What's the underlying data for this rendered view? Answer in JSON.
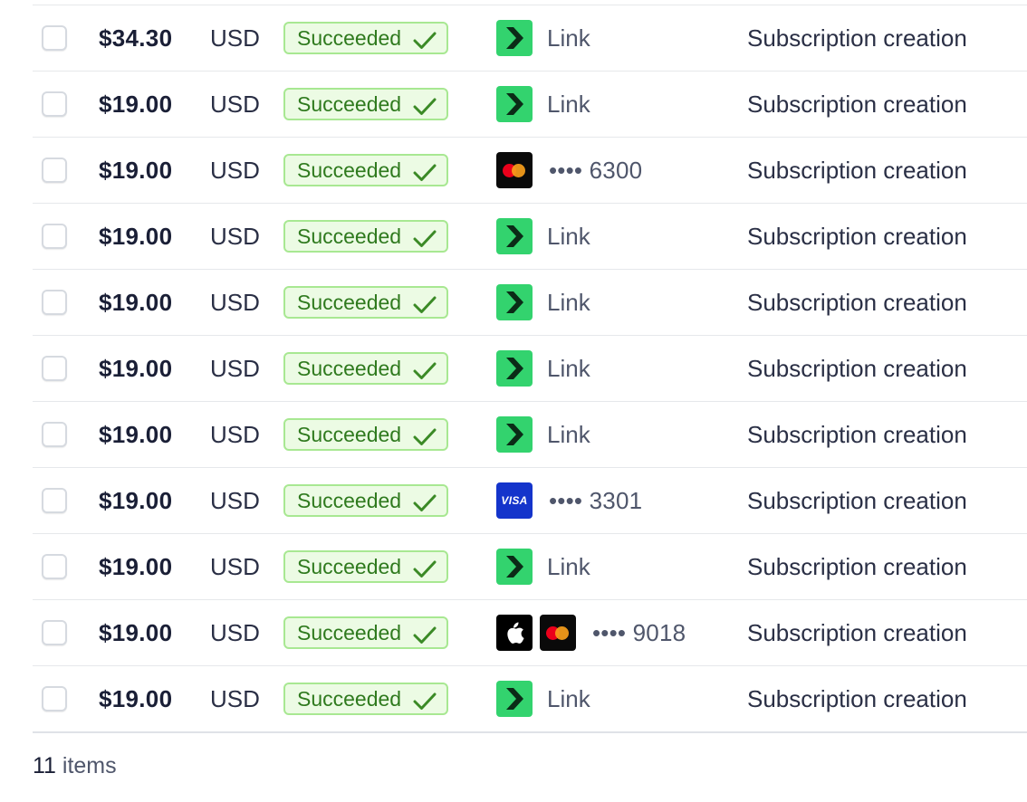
{
  "rows": [
    {
      "amount": "$34.30",
      "currency": "USD",
      "status": "Succeeded",
      "method": "link",
      "label": "Link",
      "description": "Subscription creation"
    },
    {
      "amount": "$19.00",
      "currency": "USD",
      "status": "Succeeded",
      "method": "link",
      "label": "Link",
      "description": "Subscription creation"
    },
    {
      "amount": "$19.00",
      "currency": "USD",
      "status": "Succeeded",
      "method": "mastercard",
      "label": "•••• 6300",
      "description": "Subscription creation"
    },
    {
      "amount": "$19.00",
      "currency": "USD",
      "status": "Succeeded",
      "method": "link",
      "label": "Link",
      "description": "Subscription creation"
    },
    {
      "amount": "$19.00",
      "currency": "USD",
      "status": "Succeeded",
      "method": "link",
      "label": "Link",
      "description": "Subscription creation"
    },
    {
      "amount": "$19.00",
      "currency": "USD",
      "status": "Succeeded",
      "method": "link",
      "label": "Link",
      "description": "Subscription creation"
    },
    {
      "amount": "$19.00",
      "currency": "USD",
      "status": "Succeeded",
      "method": "link",
      "label": "Link",
      "description": "Subscription creation"
    },
    {
      "amount": "$19.00",
      "currency": "USD",
      "status": "Succeeded",
      "method": "visa",
      "label": "•••• 3301",
      "visa_text": "VISA",
      "description": "Subscription creation"
    },
    {
      "amount": "$19.00",
      "currency": "USD",
      "status": "Succeeded",
      "method": "link",
      "label": "Link",
      "description": "Subscription creation"
    },
    {
      "amount": "$19.00",
      "currency": "USD",
      "status": "Succeeded",
      "method": "apple-pay-mastercard",
      "label": "•••• 9018",
      "description": "Subscription creation"
    },
    {
      "amount": "$19.00",
      "currency": "USD",
      "status": "Succeeded",
      "method": "link",
      "label": "Link",
      "description": "Subscription creation"
    }
  ],
  "footer": {
    "count": "11",
    "suffix": "items"
  },
  "colors": {
    "success_bg": "#ecfbe4",
    "success_border": "#a8e892",
    "success_text": "#2f7a1e",
    "link_green": "#33d36e",
    "visa_blue": "#1434cb"
  },
  "icons": {
    "link": "link-pay-icon",
    "mastercard": "mastercard-icon",
    "visa": "visa-icon",
    "apple": "apple-pay-icon",
    "check": "check-icon"
  }
}
